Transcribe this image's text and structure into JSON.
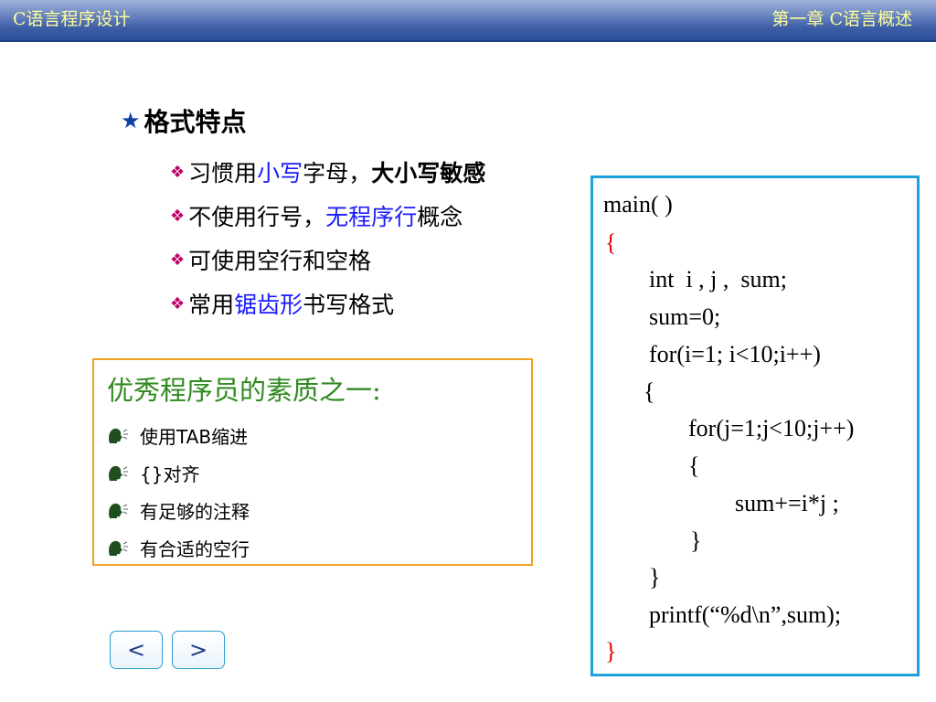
{
  "header": {
    "left_title": "C语言程序设计",
    "right_title": "第一章 C语言概述"
  },
  "main_title": {
    "star": "★",
    "text": "格式特点"
  },
  "bullets": [
    {
      "segments": [
        {
          "text": "习惯用",
          "style": "normal"
        },
        {
          "text": "小写",
          "style": "blue"
        },
        {
          "text": "字母",
          "style": "normal"
        },
        {
          "text": "，",
          "style": "normal"
        },
        {
          "text": "大小写敏感",
          "style": "bold"
        }
      ]
    },
    {
      "segments": [
        {
          "text": "不使用行号",
          "style": "normal"
        },
        {
          "text": "，",
          "style": "normal"
        },
        {
          "text": "无程序行",
          "style": "blue"
        },
        {
          "text": "概念",
          "style": "normal"
        }
      ]
    },
    {
      "segments": [
        {
          "text": "可使用空行和空格",
          "style": "normal"
        }
      ]
    },
    {
      "segments": [
        {
          "text": "常用",
          "style": "normal"
        },
        {
          "text": "锯齿形",
          "style": "blue"
        },
        {
          "text": "书写格式",
          "style": "normal"
        }
      ]
    }
  ],
  "qualities": {
    "title": "优秀程序员的素质之一:",
    "items": [
      "使用TAB缩进",
      "{}对齐",
      "有足够的注释",
      "有合适的空行"
    ]
  },
  "code": [
    "main( )",
    "{",
    "int  i , j ,  sum;",
    "sum=0;",
    "for(i=1; i<10;i++)",
    "{",
    "for(j=1;j<10;j++)",
    "{",
    "sum+=i*j ;",
    "}",
    "}",
    "printf(“%d\\n”,sum);",
    "}"
  ],
  "nav": {
    "prev_label": "<",
    "next_label": ">"
  },
  "colors": {
    "header_text": "#ffff99",
    "blue_text": "#1a1aff",
    "quality_title": "#2f8a1f",
    "code_border": "#1ea0d8",
    "quality_border": "#f0a020"
  }
}
